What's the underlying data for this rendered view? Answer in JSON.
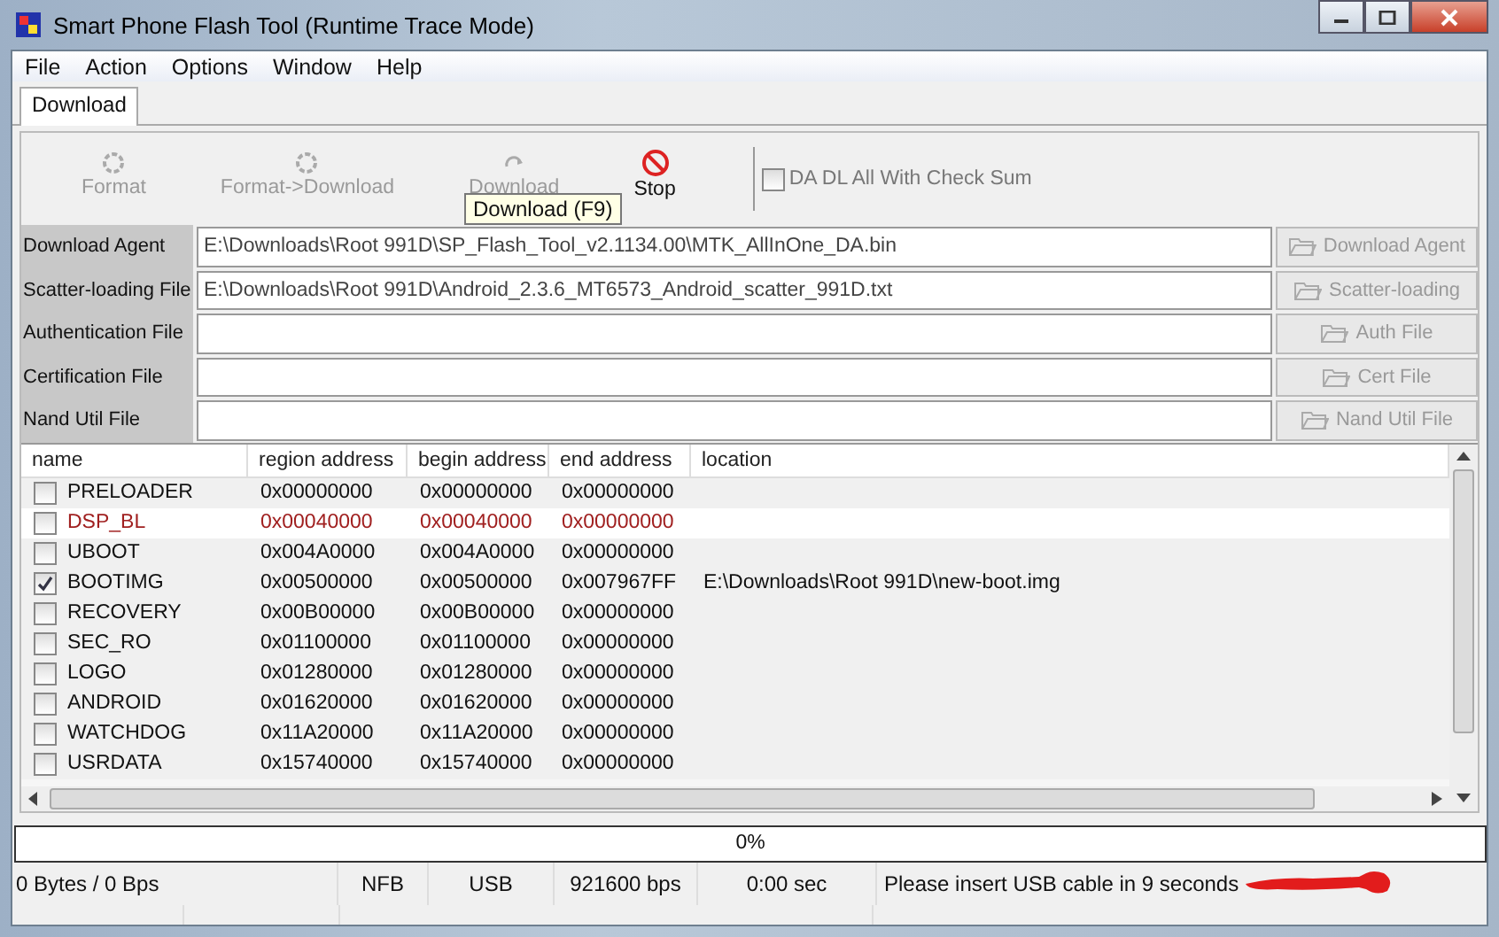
{
  "window": {
    "title": "Smart Phone Flash Tool (Runtime Trace Mode)"
  },
  "menu": [
    "File",
    "Action",
    "Options",
    "Window",
    "Help"
  ],
  "tabs": [
    {
      "label": "Download",
      "selected": true
    }
  ],
  "toolbar": [
    {
      "label": "Format",
      "kind": "gear",
      "disabled": true
    },
    {
      "label": "Format->Download",
      "kind": "gear",
      "disabled": true
    },
    {
      "label": "Download",
      "kind": "arrow",
      "disabled": true
    },
    {
      "label": "Stop",
      "kind": "stop",
      "disabled": false
    }
  ],
  "tooltip": "Download (F9)",
  "checksum": {
    "label": "DA DL All With Check Sum",
    "checked": false
  },
  "files": [
    {
      "label": "Download Agent",
      "value": "E:\\Downloads\\Root 991D\\SP_Flash_Tool_v2.1134.00\\MTK_AllInOne_DA.bin",
      "button": "Download Agent",
      "disabled": true
    },
    {
      "label": "Scatter-loading File",
      "value": "E:\\Downloads\\Root 991D\\Android_2.3.6_MT6573_Android_scatter_991D.txt",
      "button": "Scatter-loading",
      "disabled": true
    },
    {
      "label": "Authentication File",
      "button": "Auth File",
      "disabled": true
    },
    {
      "label": "Certification File",
      "button": "Cert File",
      "disabled": true
    },
    {
      "label": "Nand Util File",
      "button": "Nand Util File",
      "disabled": true
    }
  ],
  "table": {
    "columns": [
      "name",
      "region address",
      "begin address",
      "end address",
      "location"
    ],
    "rows": [
      {
        "name": "PRELOADER",
        "region": "0x00000000",
        "begin": "0x00000000",
        "end": "0x00000000",
        "checked": false,
        "selected": false
      },
      {
        "name": "DSP_BL",
        "region": "0x00040000",
        "begin": "0x00040000",
        "end": "0x00000000",
        "checked": false,
        "selected": true
      },
      {
        "name": "UBOOT",
        "region": "0x004A0000",
        "begin": "0x004A0000",
        "end": "0x00000000",
        "checked": false,
        "selected": false
      },
      {
        "name": "BOOTIMG",
        "region": "0x00500000",
        "begin": "0x00500000",
        "end": "0x007967FF",
        "location": "E:\\Downloads\\Root 991D\\new-boot.img",
        "checked": true,
        "selected": false
      },
      {
        "name": "RECOVERY",
        "region": "0x00B00000",
        "begin": "0x00B00000",
        "end": "0x00000000",
        "checked": false,
        "selected": false
      },
      {
        "name": "SEC_RO",
        "region": "0x01100000",
        "begin": "0x01100000",
        "end": "0x00000000",
        "checked": false,
        "selected": false
      },
      {
        "name": "LOGO",
        "region": "0x01280000",
        "begin": "0x01280000",
        "end": "0x00000000",
        "checked": false,
        "selected": false
      },
      {
        "name": "ANDROID",
        "region": "0x01620000",
        "begin": "0x01620000",
        "end": "0x00000000",
        "checked": false,
        "selected": false
      },
      {
        "name": "WATCHDOG",
        "region": "0x11A20000",
        "begin": "0x11A20000",
        "end": "0x00000000",
        "checked": false,
        "selected": false
      },
      {
        "name": "USRDATA",
        "region": "0x15740000",
        "begin": "0x15740000",
        "end": "0x00000000",
        "checked": false,
        "selected": false
      }
    ]
  },
  "progress": {
    "level": 0,
    "text": "0%"
  },
  "status_bar": [
    "0 Bytes / 0 Bps",
    "NFB",
    "USB",
    "921600 bps",
    "0:00 sec",
    "Please insert USB cable in 9 seconds"
  ]
}
